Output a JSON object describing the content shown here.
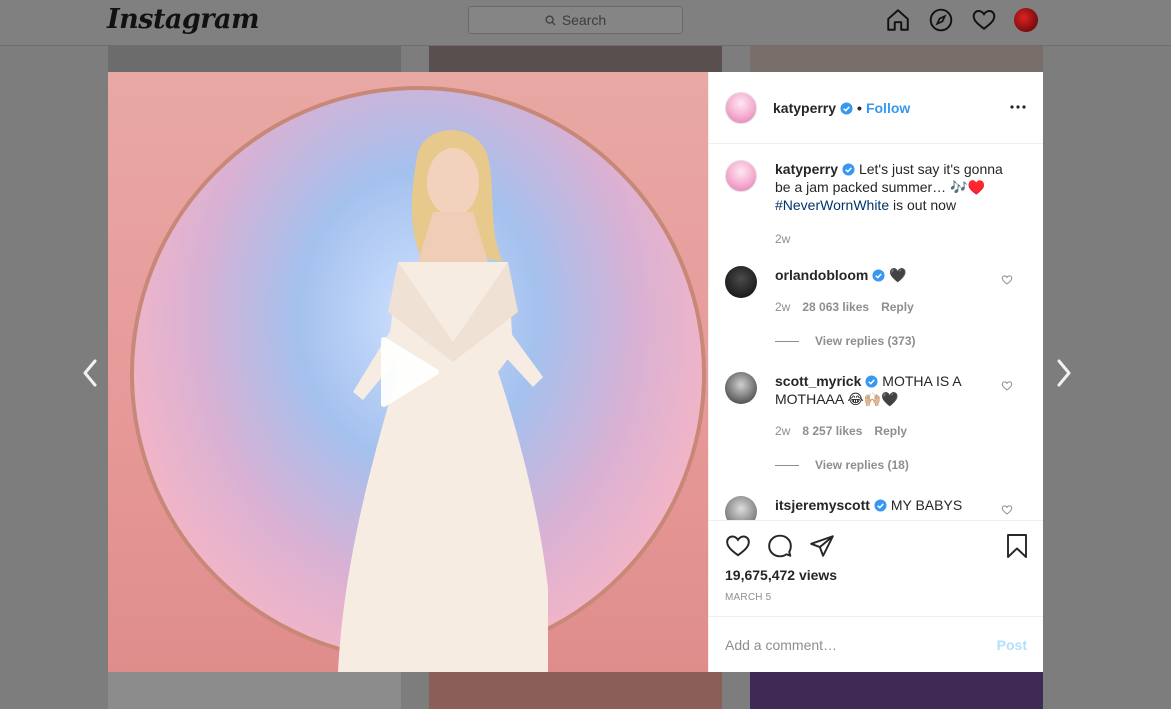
{
  "header": {
    "logo": "Instagram",
    "search_placeholder": "Search"
  },
  "nav_icons": [
    "home-icon",
    "explore-icon",
    "activity-heart-icon",
    "profile-avatar"
  ],
  "post": {
    "author": "katyperry",
    "follow_label": "Follow",
    "caption": {
      "username": "katyperry",
      "text": "Let's just say it's gonna be a jam packed summer… 🎶♥️",
      "hashtag": "#NeverWornWhite",
      "text_after": "is out now",
      "time": "2w"
    },
    "comments": [
      {
        "username": "orlandobloom",
        "text": "🖤",
        "time": "2w",
        "likes": "28 063 likes",
        "reply_label": "Reply",
        "view_replies": "View replies (373)"
      },
      {
        "username": "scott_myrick",
        "text": "MOTHA IS A MOTHAAA 😂🙌🏼🖤",
        "time": "2w",
        "likes": "8 257 likes",
        "reply_label": "Reply",
        "view_replies": "View replies (18)"
      },
      {
        "username": "itsjeremyscott",
        "text": "MY BABYS"
      }
    ],
    "views": "19,675,472 views",
    "date": "MARCH 5",
    "add_comment_placeholder": "Add a comment…",
    "post_label": "Post"
  },
  "colors": {
    "accent": "#3897f0",
    "hashtag": "#003569",
    "muted": "#8e8e8e",
    "post_disabled": "#b2dffc"
  }
}
